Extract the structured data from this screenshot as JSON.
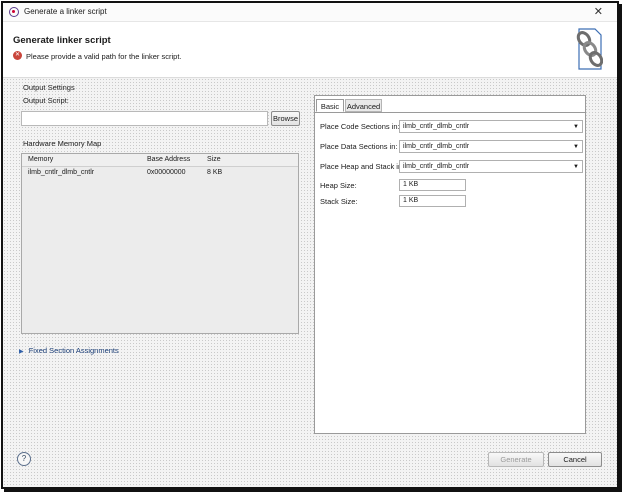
{
  "window": {
    "title": "Generate a linker script",
    "close_glyph": "✕"
  },
  "banner": {
    "title": "Generate linker script",
    "error_message": "Please provide a valid path for the linker script.",
    "error_icon": "error-icon"
  },
  "left": {
    "output_settings": "Output Settings",
    "output_script_label": "Output Script:",
    "output_script_value": "",
    "browse_label": "Browse",
    "memory_map_label": "Hardware Memory Map",
    "columns": [
      "Memory",
      "Base Address",
      "Size"
    ],
    "rows": [
      {
        "memory": "ilmb_cntlr_dlmb_cntlr",
        "base": "0x00000000",
        "size": "8 KB"
      }
    ],
    "fixed_section": "Fixed Section Assignments"
  },
  "right": {
    "tabs": [
      "Basic",
      "Advanced"
    ],
    "active_tab": "Basic",
    "code_label": "Place Code Sections in:",
    "code_value": "ilmb_cntlr_dlmb_cntlr",
    "data_label": "Place Data Sections in:",
    "data_value": "ilmb_cntlr_dlmb_cntlr",
    "heap_stack_label": "Place Heap and Stack in:",
    "heap_stack_value": "ilmb_cntlr_dlmb_cntlr",
    "heap_label": "Heap Size:",
    "heap_value": "1 KB",
    "stack_label": "Stack Size:",
    "stack_value": "1 KB"
  },
  "footer": {
    "help_glyph": "?",
    "generate_label": "Generate",
    "cancel_label": "Cancel"
  }
}
